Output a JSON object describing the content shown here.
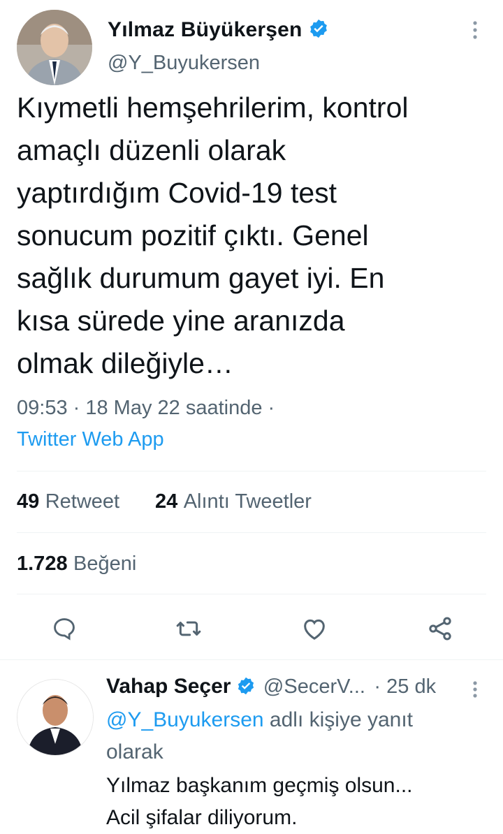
{
  "tweet": {
    "author_name": "Yılmaz Büyükerşen",
    "author_handle": "@Y_Buyukersen",
    "text_lines": [
      "Kıymetli hemşehrilerim, kontrol",
      "amaçlı düzenli olarak",
      "yaptırdığım Covid-19 test",
      "sonucum pozitif çıktı. Genel",
      "sağlık durumum gayet iyi. En",
      "kısa sürede yine aranızda",
      "olmak dileğiyle…"
    ],
    "time": "09:53 · 18 May 22 saatinde ·",
    "source": "Twitter Web App",
    "stats": {
      "retweets": "49",
      "retweets_label": "Retweet",
      "quotes": "24",
      "quotes_label": "Alıntı Tweetler",
      "likes": "1.728",
      "likes_label": "Beğeni"
    }
  },
  "actions": {
    "reply_icon": "reply-icon",
    "retweet_icon": "retweet-icon",
    "like_icon": "heart-icon",
    "share_icon": "share-icon"
  },
  "reply": {
    "author_name": "Vahap Seçer",
    "author_handle": "@SecerV...",
    "time": "· 25 dk",
    "reply_to_handle": "@Y_Buyukersen",
    "reply_to_suffix": "adlı kişiye yanıt",
    "reply_to_line2": "olarak",
    "text_lines": [
      "Yılmaz başkanım geçmiş olsun...",
      "Acil şifalar diliyorum."
    ]
  },
  "colors": {
    "accent": "#1d9bf0",
    "text": "#0f1419",
    "muted": "#536471",
    "divider": "#eff3f4"
  }
}
